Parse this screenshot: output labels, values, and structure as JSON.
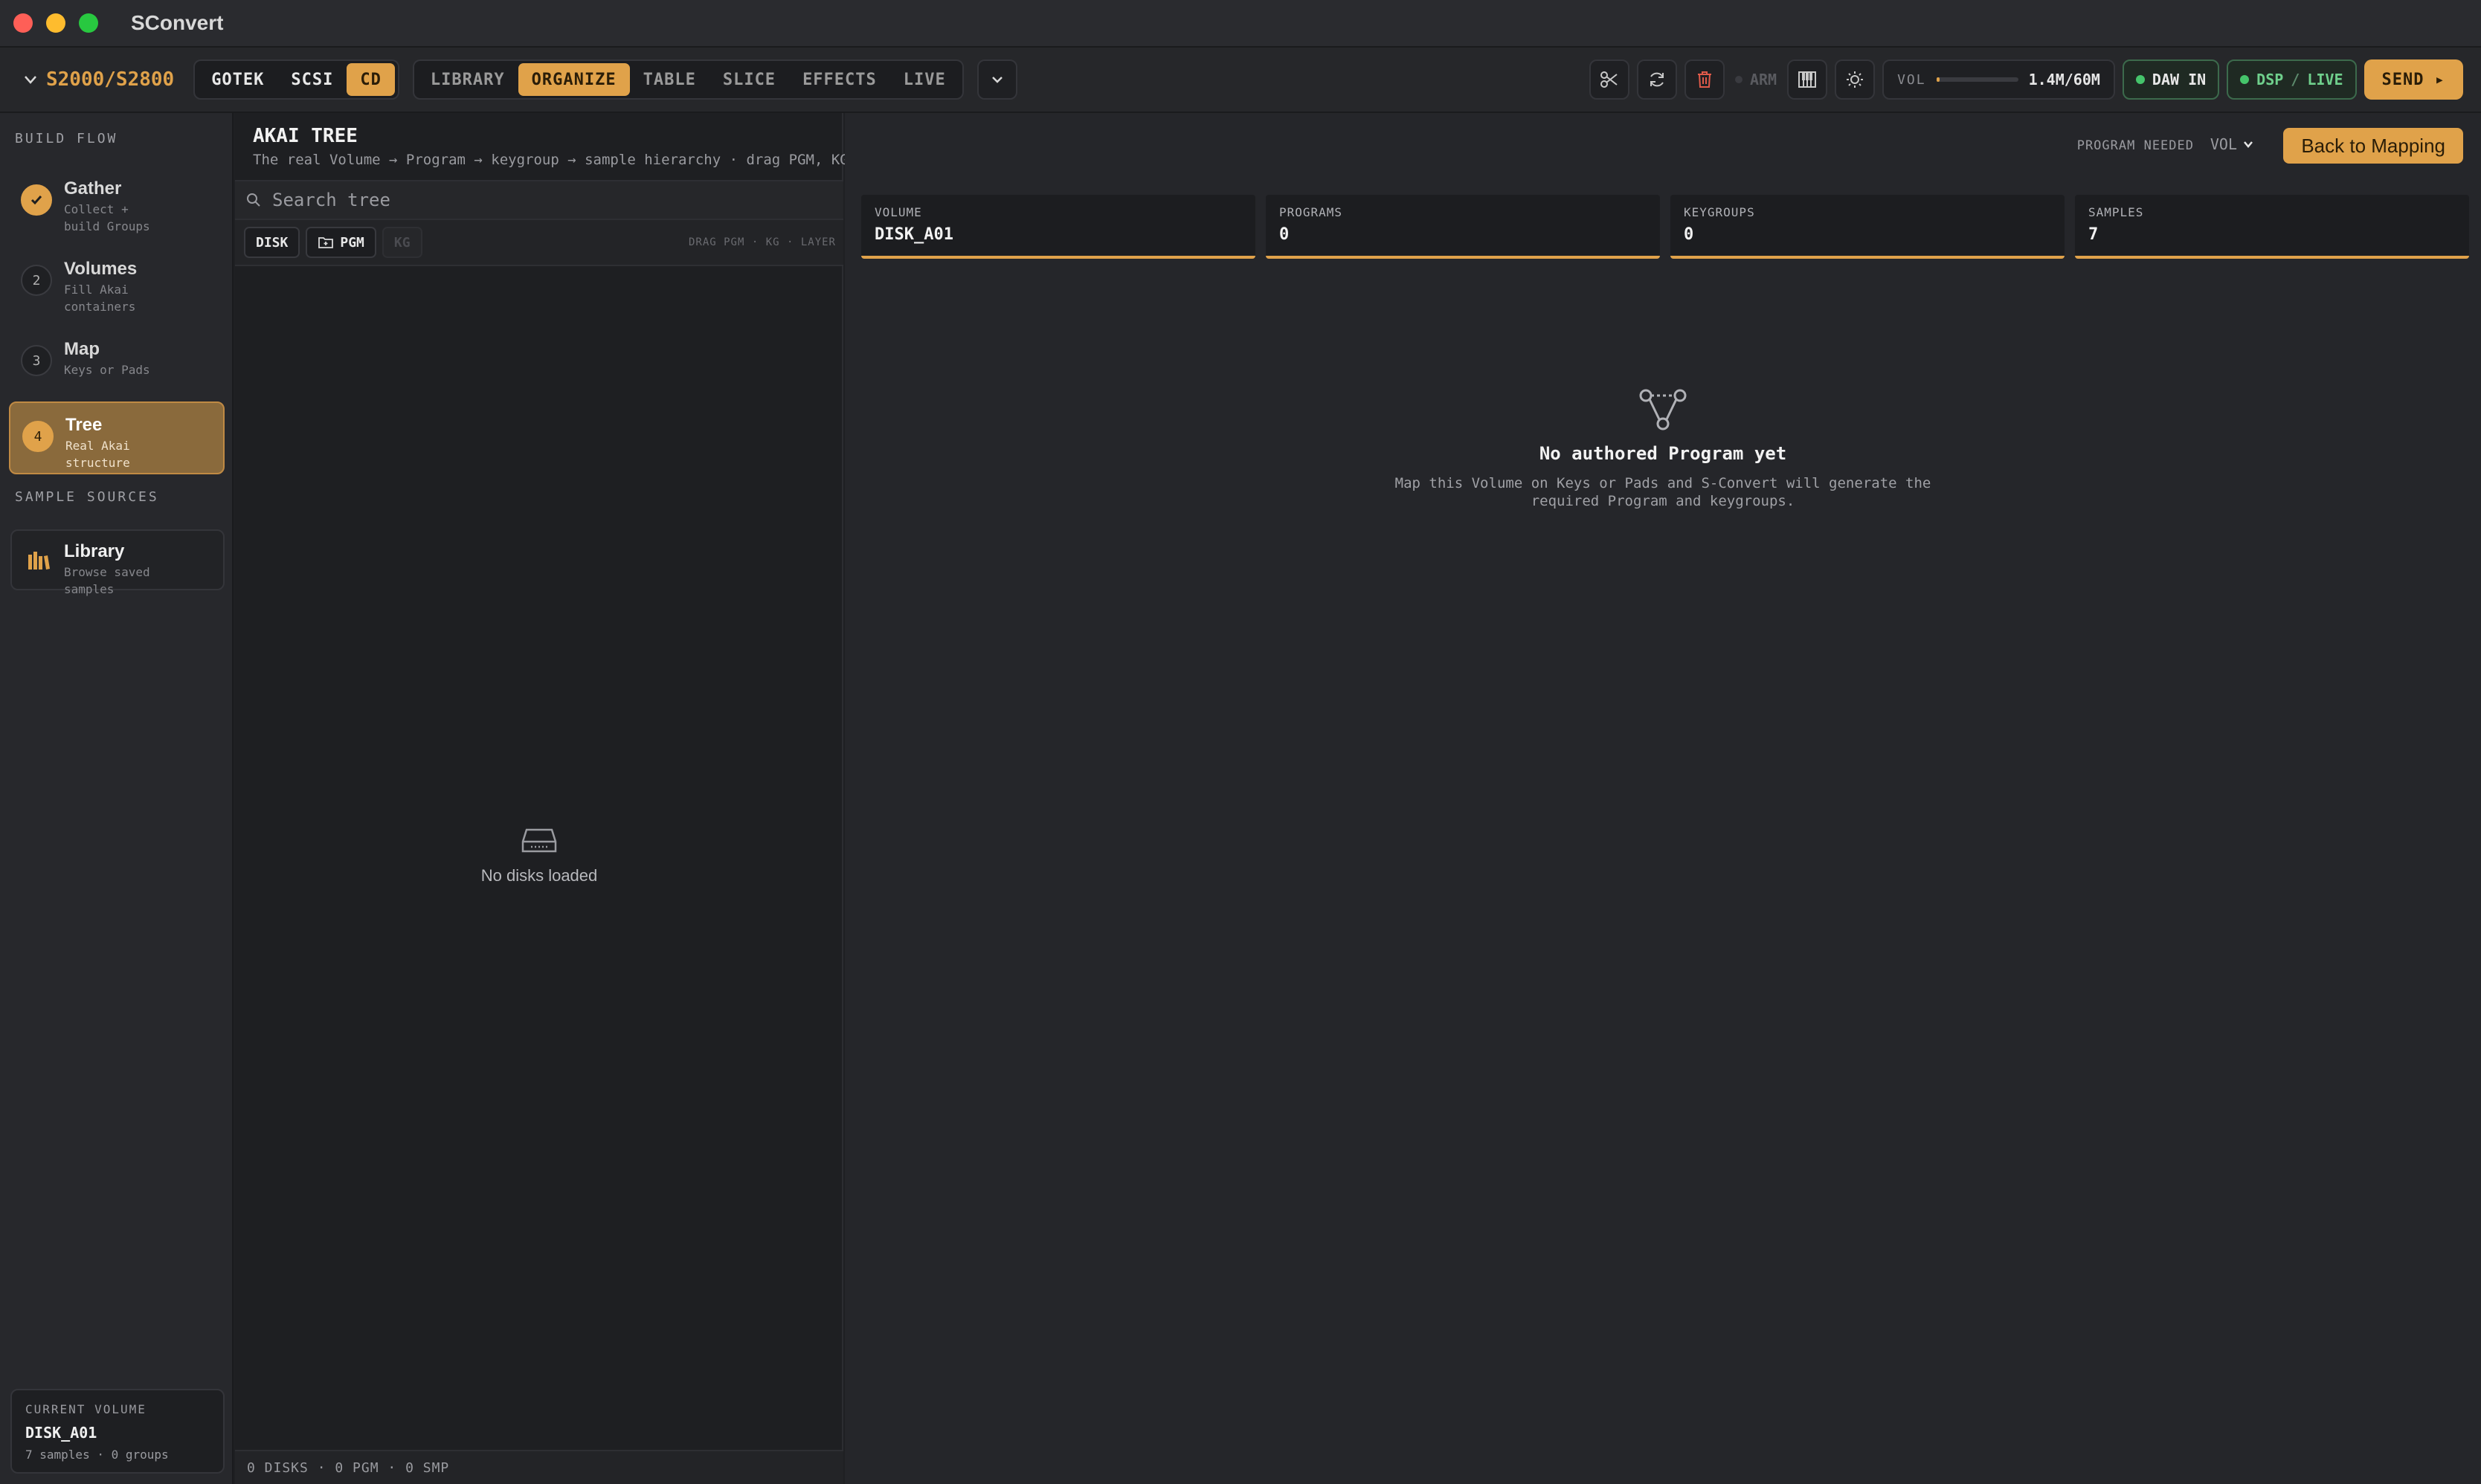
{
  "window": {
    "title": "SConvert"
  },
  "toolbar": {
    "model": "S2000/S2800",
    "media": [
      "GOTEK",
      "SCSI",
      "CD"
    ],
    "media_active": "CD",
    "views": [
      "LIBRARY",
      "ORGANIZE",
      "TABLE",
      "SLICE",
      "EFFECTS",
      "LIVE"
    ],
    "view_active": "ORGANIZE",
    "arm_label": "ARM",
    "vol_label": "VOL",
    "vol_fraction": 0.023,
    "vol_value": "1.4M/60M",
    "daw_label": "DAW IN",
    "dsp_label": "DSP",
    "dsp_sep": "/",
    "live_label": "LIVE",
    "send_label": "SEND ▸"
  },
  "sidebar": {
    "build_flow_heading": "BUILD FLOW",
    "steps": [
      {
        "num": "",
        "title": "Gather",
        "sub1": "Collect +",
        "sub2": "build Groups"
      },
      {
        "num": "2",
        "title": "Volumes",
        "sub1": "Fill Akai",
        "sub2": "containers"
      },
      {
        "num": "3",
        "title": "Map",
        "sub1": "Keys or Pads",
        "sub2": ""
      },
      {
        "num": "4",
        "title": "Tree",
        "sub1": "Real Akai",
        "sub2": "structure"
      }
    ],
    "sources_heading": "SAMPLE SOURCES",
    "library": {
      "title": "Library",
      "sub1": "Browse saved",
      "sub2": "samples"
    },
    "current_volume": {
      "heading": "CURRENT VOLUME",
      "name": "DISK_A01",
      "meta": "7 samples · 0 groups"
    }
  },
  "tree": {
    "title": "AKAI TREE",
    "description": "The real Volume → Program → keygroup → sample hierarchy · drag PGM, KG, and layers to edit",
    "search_placeholder": "Search tree",
    "filters": {
      "disk": "DISK",
      "pgm": "PGM",
      "kg": "KG"
    },
    "drag_hint": "DRAG PGM · KG · LAYER",
    "empty_text": "No disks loaded",
    "footer": "0 DISKS · 0 PGM · 0 SMP"
  },
  "main": {
    "program_needed": "PROGRAM NEEDED",
    "vol_dropdown": "VOL",
    "back_button": "Back to Mapping",
    "stats": [
      {
        "label": "VOLUME",
        "value": "DISK_A01"
      },
      {
        "label": "PROGRAMS",
        "value": "0"
      },
      {
        "label": "KEYGROUPS",
        "value": "0"
      },
      {
        "label": "SAMPLES",
        "value": "7"
      }
    ],
    "empty_title": "No authored Program yet",
    "empty_line1": "Map this Volume on Keys or Pads and S-Convert will generate the",
    "empty_line2": "required Program and keygroups."
  },
  "colors": {
    "accent": "#e0a24a",
    "green": "#45c46b",
    "danger": "#e05a4a"
  }
}
